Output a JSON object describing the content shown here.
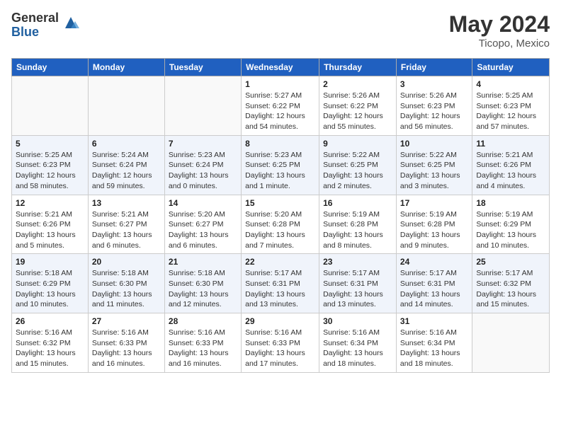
{
  "header": {
    "logo_general": "General",
    "logo_blue": "Blue",
    "month_year": "May 2024",
    "location": "Ticopo, Mexico"
  },
  "days_of_week": [
    "Sunday",
    "Monday",
    "Tuesday",
    "Wednesday",
    "Thursday",
    "Friday",
    "Saturday"
  ],
  "weeks": [
    [
      {
        "day": "",
        "sunrise": "",
        "sunset": "",
        "daylight": ""
      },
      {
        "day": "",
        "sunrise": "",
        "sunset": "",
        "daylight": ""
      },
      {
        "day": "",
        "sunrise": "",
        "sunset": "",
        "daylight": ""
      },
      {
        "day": "1",
        "sunrise": "Sunrise: 5:27 AM",
        "sunset": "Sunset: 6:22 PM",
        "daylight": "Daylight: 12 hours and 54 minutes."
      },
      {
        "day": "2",
        "sunrise": "Sunrise: 5:26 AM",
        "sunset": "Sunset: 6:22 PM",
        "daylight": "Daylight: 12 hours and 55 minutes."
      },
      {
        "day": "3",
        "sunrise": "Sunrise: 5:26 AM",
        "sunset": "Sunset: 6:23 PM",
        "daylight": "Daylight: 12 hours and 56 minutes."
      },
      {
        "day": "4",
        "sunrise": "Sunrise: 5:25 AM",
        "sunset": "Sunset: 6:23 PM",
        "daylight": "Daylight: 12 hours and 57 minutes."
      }
    ],
    [
      {
        "day": "5",
        "sunrise": "Sunrise: 5:25 AM",
        "sunset": "Sunset: 6:23 PM",
        "daylight": "Daylight: 12 hours and 58 minutes."
      },
      {
        "day": "6",
        "sunrise": "Sunrise: 5:24 AM",
        "sunset": "Sunset: 6:24 PM",
        "daylight": "Daylight: 12 hours and 59 minutes."
      },
      {
        "day": "7",
        "sunrise": "Sunrise: 5:23 AM",
        "sunset": "Sunset: 6:24 PM",
        "daylight": "Daylight: 13 hours and 0 minutes."
      },
      {
        "day": "8",
        "sunrise": "Sunrise: 5:23 AM",
        "sunset": "Sunset: 6:25 PM",
        "daylight": "Daylight: 13 hours and 1 minute."
      },
      {
        "day": "9",
        "sunrise": "Sunrise: 5:22 AM",
        "sunset": "Sunset: 6:25 PM",
        "daylight": "Daylight: 13 hours and 2 minutes."
      },
      {
        "day": "10",
        "sunrise": "Sunrise: 5:22 AM",
        "sunset": "Sunset: 6:25 PM",
        "daylight": "Daylight: 13 hours and 3 minutes."
      },
      {
        "day": "11",
        "sunrise": "Sunrise: 5:21 AM",
        "sunset": "Sunset: 6:26 PM",
        "daylight": "Daylight: 13 hours and 4 minutes."
      }
    ],
    [
      {
        "day": "12",
        "sunrise": "Sunrise: 5:21 AM",
        "sunset": "Sunset: 6:26 PM",
        "daylight": "Daylight: 13 hours and 5 minutes."
      },
      {
        "day": "13",
        "sunrise": "Sunrise: 5:21 AM",
        "sunset": "Sunset: 6:27 PM",
        "daylight": "Daylight: 13 hours and 6 minutes."
      },
      {
        "day": "14",
        "sunrise": "Sunrise: 5:20 AM",
        "sunset": "Sunset: 6:27 PM",
        "daylight": "Daylight: 13 hours and 6 minutes."
      },
      {
        "day": "15",
        "sunrise": "Sunrise: 5:20 AM",
        "sunset": "Sunset: 6:28 PM",
        "daylight": "Daylight: 13 hours and 7 minutes."
      },
      {
        "day": "16",
        "sunrise": "Sunrise: 5:19 AM",
        "sunset": "Sunset: 6:28 PM",
        "daylight": "Daylight: 13 hours and 8 minutes."
      },
      {
        "day": "17",
        "sunrise": "Sunrise: 5:19 AM",
        "sunset": "Sunset: 6:28 PM",
        "daylight": "Daylight: 13 hours and 9 minutes."
      },
      {
        "day": "18",
        "sunrise": "Sunrise: 5:19 AM",
        "sunset": "Sunset: 6:29 PM",
        "daylight": "Daylight: 13 hours and 10 minutes."
      }
    ],
    [
      {
        "day": "19",
        "sunrise": "Sunrise: 5:18 AM",
        "sunset": "Sunset: 6:29 PM",
        "daylight": "Daylight: 13 hours and 10 minutes."
      },
      {
        "day": "20",
        "sunrise": "Sunrise: 5:18 AM",
        "sunset": "Sunset: 6:30 PM",
        "daylight": "Daylight: 13 hours and 11 minutes."
      },
      {
        "day": "21",
        "sunrise": "Sunrise: 5:18 AM",
        "sunset": "Sunset: 6:30 PM",
        "daylight": "Daylight: 13 hours and 12 minutes."
      },
      {
        "day": "22",
        "sunrise": "Sunrise: 5:17 AM",
        "sunset": "Sunset: 6:31 PM",
        "daylight": "Daylight: 13 hours and 13 minutes."
      },
      {
        "day": "23",
        "sunrise": "Sunrise: 5:17 AM",
        "sunset": "Sunset: 6:31 PM",
        "daylight": "Daylight: 13 hours and 13 minutes."
      },
      {
        "day": "24",
        "sunrise": "Sunrise: 5:17 AM",
        "sunset": "Sunset: 6:31 PM",
        "daylight": "Daylight: 13 hours and 14 minutes."
      },
      {
        "day": "25",
        "sunrise": "Sunrise: 5:17 AM",
        "sunset": "Sunset: 6:32 PM",
        "daylight": "Daylight: 13 hours and 15 minutes."
      }
    ],
    [
      {
        "day": "26",
        "sunrise": "Sunrise: 5:16 AM",
        "sunset": "Sunset: 6:32 PM",
        "daylight": "Daylight: 13 hours and 15 minutes."
      },
      {
        "day": "27",
        "sunrise": "Sunrise: 5:16 AM",
        "sunset": "Sunset: 6:33 PM",
        "daylight": "Daylight: 13 hours and 16 minutes."
      },
      {
        "day": "28",
        "sunrise": "Sunrise: 5:16 AM",
        "sunset": "Sunset: 6:33 PM",
        "daylight": "Daylight: 13 hours and 16 minutes."
      },
      {
        "day": "29",
        "sunrise": "Sunrise: 5:16 AM",
        "sunset": "Sunset: 6:33 PM",
        "daylight": "Daylight: 13 hours and 17 minutes."
      },
      {
        "day": "30",
        "sunrise": "Sunrise: 5:16 AM",
        "sunset": "Sunset: 6:34 PM",
        "daylight": "Daylight: 13 hours and 18 minutes."
      },
      {
        "day": "31",
        "sunrise": "Sunrise: 5:16 AM",
        "sunset": "Sunset: 6:34 PM",
        "daylight": "Daylight: 13 hours and 18 minutes."
      },
      {
        "day": "",
        "sunrise": "",
        "sunset": "",
        "daylight": ""
      }
    ]
  ]
}
